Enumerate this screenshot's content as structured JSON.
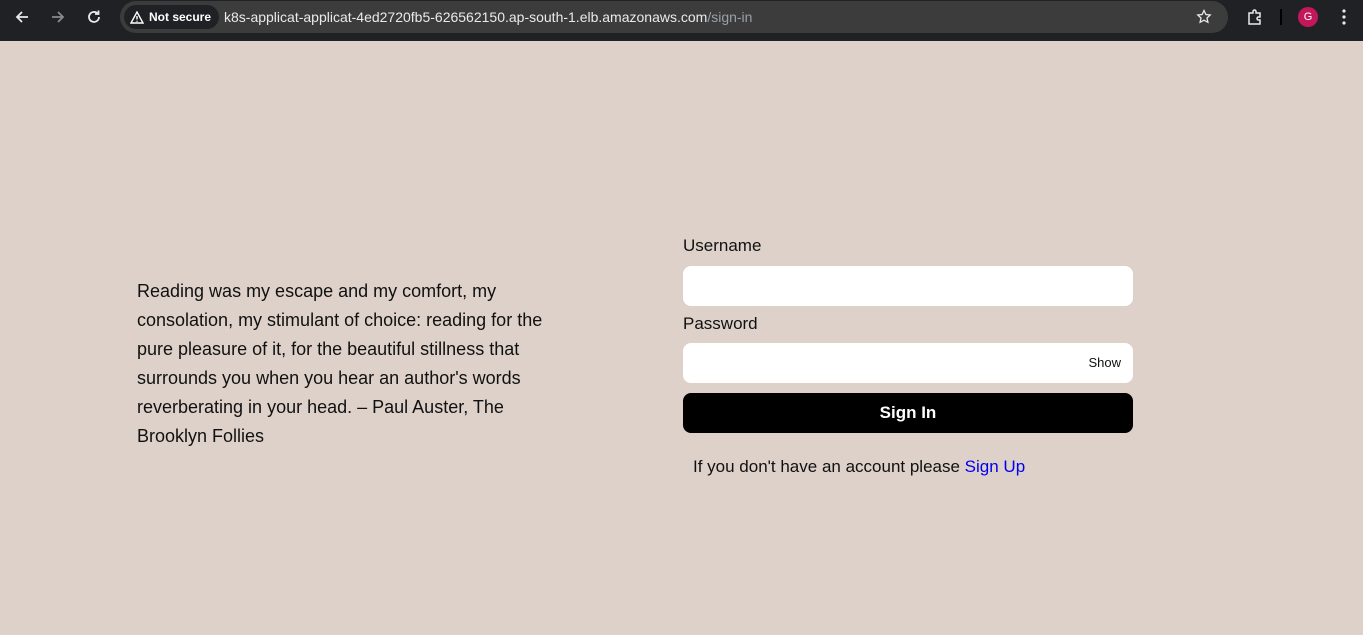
{
  "browser": {
    "security_label": "Not secure",
    "url_host": "k8s-applicat-applicat-4ed2720fb5-626562150.ap-south-1.elb.amazonaws.com",
    "url_path": "/sign-in",
    "profile_initial": "G",
    "icons": [
      "back-arrow-icon",
      "forward-arrow-icon",
      "reload-icon",
      "warning-icon",
      "star-icon",
      "extensions-icon",
      "kebab-menu-icon"
    ]
  },
  "quote": {
    "text": "Reading was my escape and my comfort, my consolation, my stimulant of choice: reading for the pure pleasure of it, for the beautiful stillness that surrounds you when you hear an author's words reverberating in your head. – Paul Auster, The Brooklyn Follies"
  },
  "form": {
    "username_label": "Username",
    "username_value": "",
    "password_label": "Password",
    "password_value": "",
    "show_label": "Show",
    "submit_label": "Sign In",
    "signup_prompt": "If you don't have an account please ",
    "signup_link": "Sign Up"
  },
  "colors": {
    "page_background": "#ddd1c9",
    "button_background": "#000000",
    "link": "#0000ee"
  }
}
